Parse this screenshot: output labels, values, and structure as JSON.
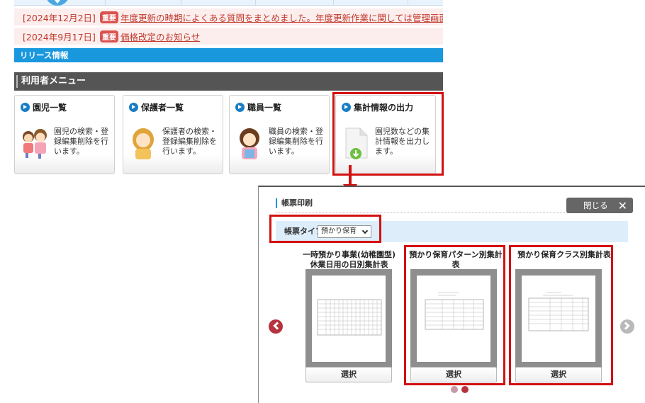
{
  "notices": [
    {
      "date": "[2024年12月2日]",
      "badge": "重要",
      "text": "年度更新の時期によくある質問をまとめました。年度更新作業に関しては管理画面右上「"
    },
    {
      "date": "[2024年9月17日]",
      "badge": "重要",
      "text": "価格改定のお知らせ"
    }
  ],
  "release_bar": "リリース情報",
  "menu": {
    "title": "利用者メニュー",
    "cards": [
      {
        "title": "園児一覧",
        "desc": "園児の検索・登録編集削除を行います。",
        "icon": "children-icon"
      },
      {
        "title": "保護者一覧",
        "desc": "保護者の検索・登録編集削除を行います。",
        "icon": "parent-icon"
      },
      {
        "title": "職員一覧",
        "desc": "職員の検索・登録編集削除を行います。",
        "icon": "staff-icon"
      },
      {
        "title": "集計情報の出力",
        "desc": "園児数などの集計情報を出力します。",
        "icon": "download-document-icon"
      }
    ]
  },
  "modal": {
    "title": "帳票印刷",
    "close_label": "閉じる",
    "type_label": "帳票タイプ",
    "type_value": "預かり保育",
    "reports": [
      {
        "title_line1": "一時預かり事業(幼稚園型)",
        "title_line2": "休業日用の日別集計表",
        "button": "選択"
      },
      {
        "title_line1": "預かり保育パターン別集計",
        "title_line2": "表",
        "button": "選択"
      },
      {
        "title_line1": "預かり保育クラス別集計表",
        "title_line2": "",
        "button": "選択"
      }
    ],
    "pagination": {
      "current": 2,
      "total": 2
    }
  },
  "colors": {
    "accent_blue": "#1a98de",
    "highlight_red": "#d31010",
    "notice_red": "#c0392b",
    "header_gray": "#555555"
  }
}
